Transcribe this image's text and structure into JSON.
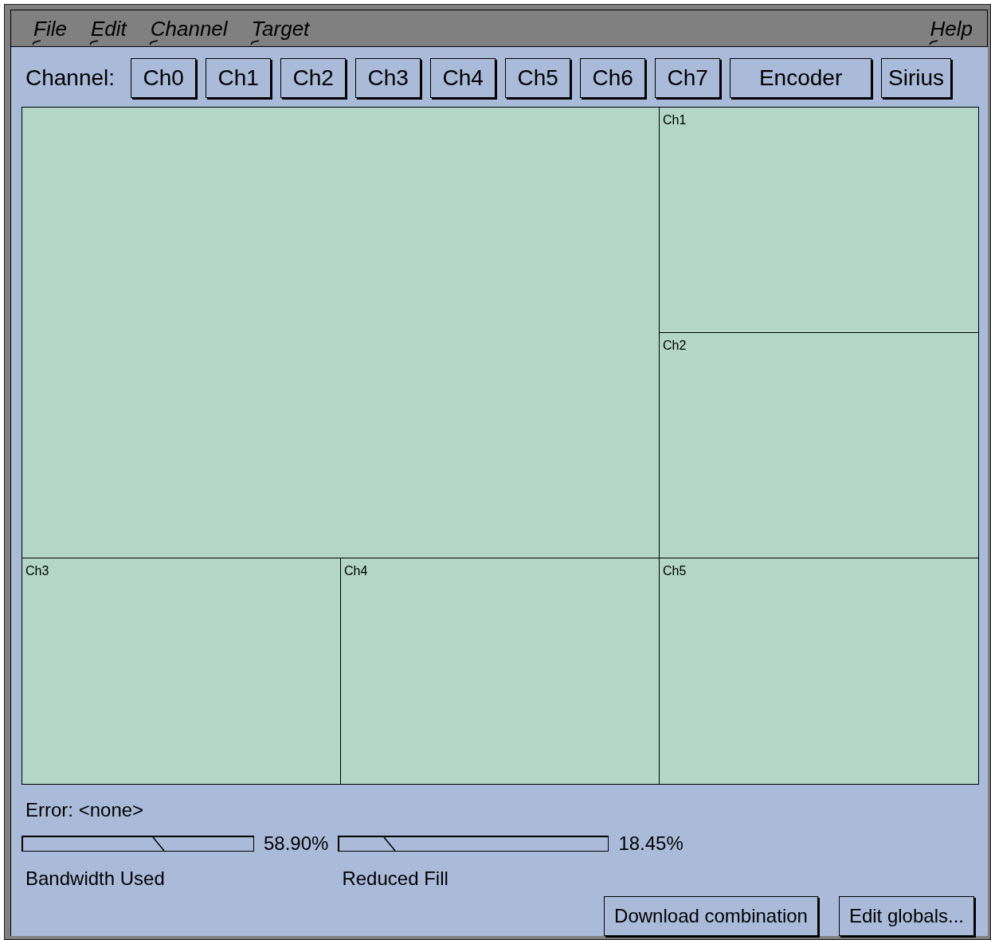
{
  "menu": [
    {
      "label": "File",
      "kind": "menu"
    },
    {
      "label": "Edit",
      "kind": "menu"
    },
    {
      "label": "Channel",
      "kind": "menu"
    },
    {
      "label": "Target",
      "kind": "menu"
    },
    {
      "label": "Help",
      "kind": "help"
    }
  ],
  "channel_bar": {
    "label": "Channel:",
    "buttons": [
      {
        "label": "Ch0",
        "kind": "narrow"
      },
      {
        "label": "Ch1",
        "kind": "narrow"
      },
      {
        "label": "Ch2",
        "kind": "narrow"
      },
      {
        "label": "Ch3",
        "kind": "narrow"
      },
      {
        "label": "Ch4",
        "kind": "narrow"
      },
      {
        "label": "Ch5",
        "kind": "narrow"
      },
      {
        "label": "Ch6",
        "kind": "narrow"
      },
      {
        "label": "Ch7",
        "kind": "narrow"
      },
      {
        "label": "Encoder",
        "kind": "wide"
      },
      {
        "label": "Sirius",
        "kind": "narrow"
      }
    ]
  },
  "panels": [
    {
      "kind": "large"
    },
    {
      "kind": "small",
      "label": "Ch1"
    },
    {
      "kind": "small",
      "label": "Ch2"
    },
    {
      "kind": "small",
      "label": "Ch3"
    },
    {
      "kind": "small",
      "label": "Ch4"
    },
    {
      "kind": "small",
      "label": "Ch5"
    }
  ],
  "error": "Error: <none>",
  "gauges": [
    {
      "label": "Bandwidth Used",
      "reading": "58.90%",
      "level": 0.589,
      "kind": "short"
    },
    {
      "label": "Reduced Fill",
      "reading": "18.45%",
      "level": 0.1845,
      "kind": "long"
    }
  ],
  "buttons": [
    {
      "label": "Download combination"
    },
    {
      "label": "Edit globals..."
    }
  ]
}
